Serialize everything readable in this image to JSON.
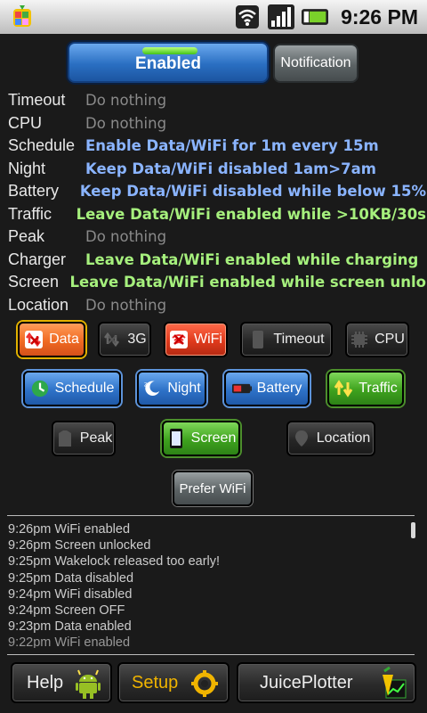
{
  "status_bar": {
    "time": "9:26 PM",
    "icons": [
      "juicedefender-app-icon",
      "wifi-icon",
      "signal-icon",
      "battery-icon"
    ]
  },
  "header": {
    "enabled_label": "Enabled",
    "notification_label": "Notification"
  },
  "rules": [
    {
      "label": "Timeout",
      "value": "Do nothing",
      "style": "none"
    },
    {
      "label": "CPU",
      "value": "Do nothing",
      "style": "none"
    },
    {
      "label": "Schedule",
      "value": "Enable Data/WiFi for 1m every 15m",
      "style": "blue"
    },
    {
      "label": "Night",
      "value": "Keep Data/WiFi disabled 1am>7am",
      "style": "blue"
    },
    {
      "label": "Battery",
      "value": "Keep Data/WiFi disabled while below 15%",
      "style": "blue"
    },
    {
      "label": "Traffic",
      "value": "Leave Data/WiFi enabled while >10KB/30s",
      "style": "green"
    },
    {
      "label": "Peak",
      "value": "Do nothing",
      "style": "none"
    },
    {
      "label": "Charger",
      "value": "Leave Data/WiFi enabled while charging",
      "style": "green"
    },
    {
      "label": "Screen",
      "value": "Leave Data/WiFi enabled while screen unlo",
      "style": "green"
    },
    {
      "label": "Location",
      "value": "Do nothing",
      "style": "none"
    }
  ],
  "toggles": {
    "data": "Data",
    "g3": "3G",
    "wifi": "WiFi",
    "timeout": "Timeout",
    "cpu": "CPU",
    "schedule": "Schedule",
    "night": "Night",
    "battery": "Battery",
    "traffic": "Traffic",
    "peak": "Peak",
    "screen": "Screen",
    "location": "Location",
    "prefer_wifi": "Prefer WiFi"
  },
  "log": [
    "9:26pm WiFi enabled",
    "9:26pm Screen unlocked",
    "9:25pm Wakelock released too early!",
    "9:25pm Data disabled",
    "9:24pm WiFi disabled",
    "9:24pm Screen OFF",
    "9:23pm Data enabled",
    "9:22pm WiFi enabled"
  ],
  "bottom_bar": {
    "help": "Help",
    "setup": "Setup",
    "juiceplotter": "JuicePlotter"
  },
  "colors": {
    "enabled_blue": "#2a6fc2",
    "active_green": "#3ea21e",
    "orange": "#f06a22",
    "setup_text": "#f0b400",
    "rule_blue": "#8ab4ff",
    "rule_green": "#a6f07d"
  }
}
